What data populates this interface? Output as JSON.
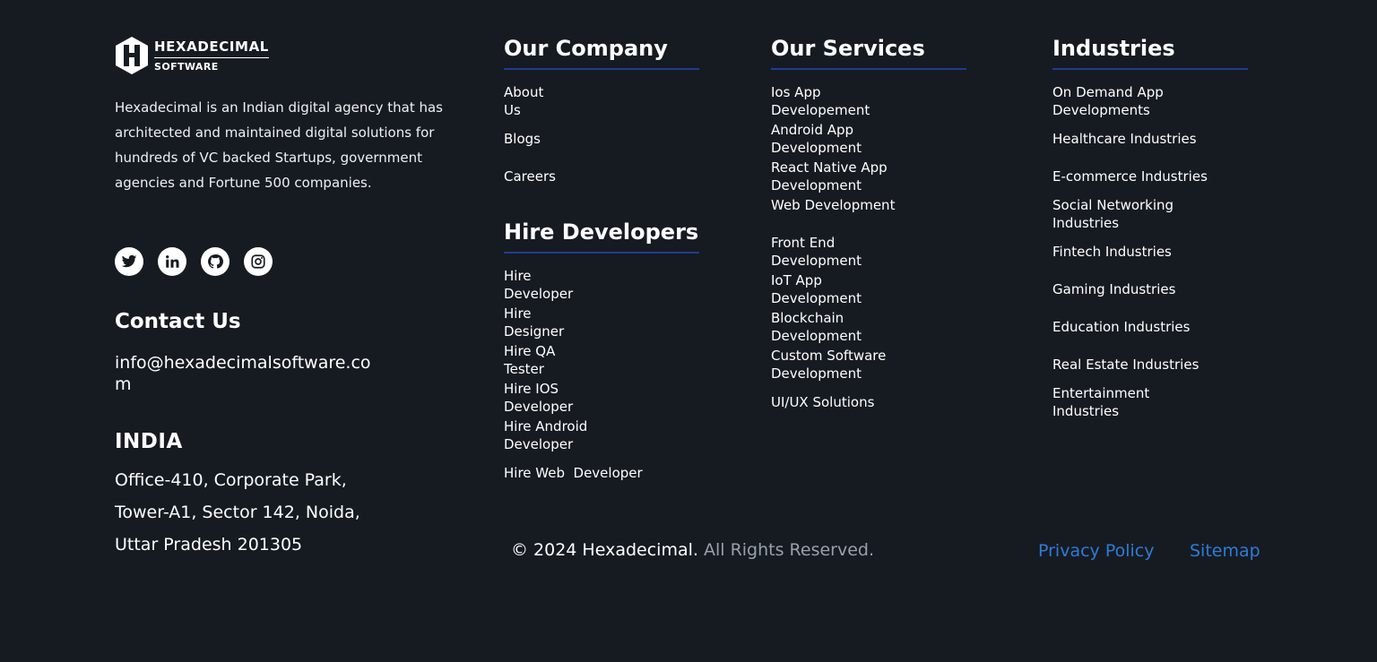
{
  "brand": {
    "logo_name": "HEXADECIMAL",
    "logo_sub": "SOFTWARE",
    "description": "Hexadecimal is an Indian digital agency that has architected and maintained digital solutions for hundreds of VC backed Startups, government agencies and Fortune 500 companies."
  },
  "socials": [
    "twitter-icon",
    "linkedin-icon",
    "github-icon",
    "instagram-icon"
  ],
  "contact": {
    "title": "Contact Us",
    "email": "info@hexadecimalsoftware.com",
    "country": "INDIA",
    "address": "Office-410, Corporate Park, Tower-A1, Sector 142, Noida, Uttar Pradesh 201305"
  },
  "company": {
    "title": "Our Company",
    "links": [
      "About Us",
      "Blogs",
      "Careers"
    ]
  },
  "hire": {
    "title": "Hire Developers",
    "links": [
      "Hire Developer",
      "Hire Designer",
      "Hire QA Tester",
      "Hire IOS Developer",
      "Hire Android Developer",
      "Hire Web  Developer"
    ]
  },
  "services": {
    "title": "Our Services",
    "links": [
      "Ios App Developement",
      "Android App Development",
      "React Native App Development",
      "Web Development",
      "Front End Development",
      "IoT App Development",
      "Blockchain Development",
      "Custom Software Development",
      "UI/UX Solutions"
    ]
  },
  "industries": {
    "title": "Industries",
    "links": [
      "On Demand App Developments",
      "Healthcare Industries",
      "E-commerce Industries",
      "Social Networking Industries",
      "Fintech Industries",
      "Gaming Industries",
      "Education Industries",
      "Real Estate Industries",
      "Entertainment Industries"
    ]
  },
  "bottom": {
    "copyright": "© 2024 Hexadecimal.",
    "rights": "All Rights Reserved.",
    "privacy": "Privacy Policy",
    "sitemap": "Sitemap"
  },
  "colors": {
    "background": "#161b22",
    "accent_line": "#1d3d8f",
    "link_blue": "#2f7bd6"
  }
}
